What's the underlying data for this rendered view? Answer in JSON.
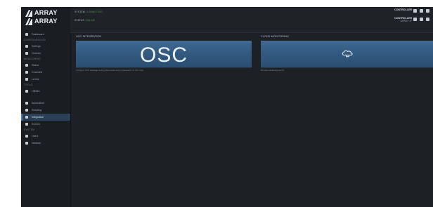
{
  "app": {
    "logo_lines": [
      "ARRAY",
      "ARRAY"
    ],
    "brand_color": "#e9edf1"
  },
  "topbar": {
    "lines": [
      {
        "key": "SYSTEM",
        "value": "CONNECTED"
      },
      {
        "key": "STATUS",
        "value": "ONLINE"
      }
    ],
    "right": [
      {
        "name": "CONTROLLER",
        "sub": "ARRAY IP"
      },
      {
        "name": "CONTROLLER",
        "sub": "ARRAY IP"
      }
    ]
  },
  "sidebar": {
    "sections": [
      {
        "heading": "",
        "items": [
          {
            "label": "Dashboard",
            "icon": "dashboard-icon"
          }
        ]
      },
      {
        "heading": "CONFIGURATION",
        "items": [
          {
            "label": "Settings",
            "icon": "gear-icon"
          },
          {
            "label": "Devices",
            "icon": "device-icon"
          }
        ]
      },
      {
        "heading": "MONITORING",
        "items": [
          {
            "label": "Status",
            "icon": "status-icon"
          },
          {
            "label": "Channels",
            "icon": "channels-icon"
          },
          {
            "label": "Levels",
            "icon": "levels-icon"
          }
        ]
      },
      {
        "heading": "TOOLS",
        "items": [
          {
            "label": "Utilities",
            "icon": "tools-icon"
          }
        ]
      },
      {
        "heading": "",
        "items": [
          {
            "label": "Automation",
            "icon": "automation-icon"
          },
          {
            "label": "Scripting",
            "icon": "script-icon"
          },
          {
            "label": "Integration",
            "icon": "integration-icon",
            "active": true
          },
          {
            "label": "Scenes",
            "icon": "scenes-icon"
          }
        ]
      },
      {
        "heading": "SYSTEM",
        "items": [
          {
            "label": "Users",
            "icon": "users-icon"
          },
          {
            "label": "Network",
            "icon": "network-icon"
          }
        ]
      }
    ]
  },
  "cards": [
    {
      "title": "OSC INTEGRATION",
      "banner_text": "OSC",
      "banner_icon": "cloud-monitor-icon",
      "description": "Configure OSC message routing and remote control parameters for this array."
    },
    {
      "title": "CLOUD MONITORING",
      "banner_text": "",
      "banner_icon": "cloud-monitor-icon",
      "description": "Remote monitoring service."
    }
  ]
}
